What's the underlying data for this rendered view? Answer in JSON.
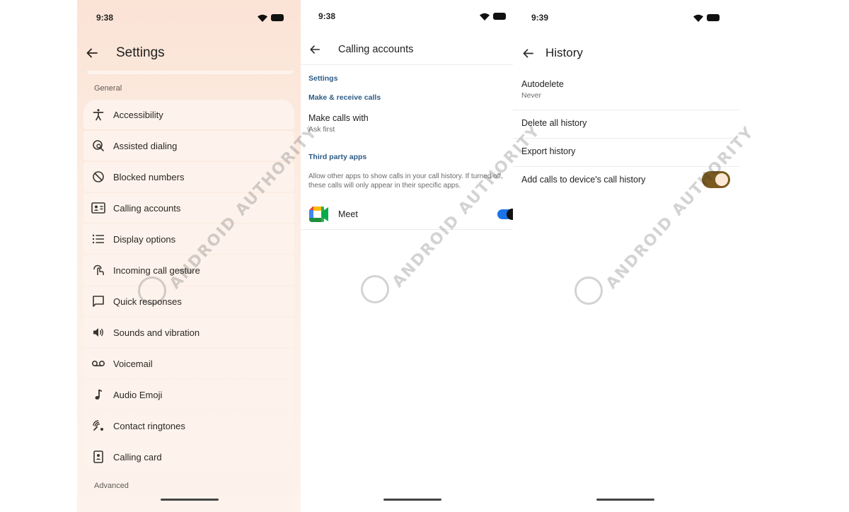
{
  "settings_screen": {
    "time": "9:38",
    "title": "Settings",
    "general_label": "General",
    "advanced_label": "Advanced",
    "items": [
      {
        "label": "Accessibility",
        "icon": "accessibility-icon"
      },
      {
        "label": "Assisted dialing",
        "icon": "assisted-dialing-icon"
      },
      {
        "label": "Blocked numbers",
        "icon": "block-icon"
      },
      {
        "label": "Calling accounts",
        "icon": "contact-card-icon"
      },
      {
        "label": "Display options",
        "icon": "list-icon"
      },
      {
        "label": "Incoming call gesture",
        "icon": "gesture-icon"
      },
      {
        "label": "Quick responses",
        "icon": "chat-bubble-icon"
      },
      {
        "label": "Sounds and vibration",
        "icon": "volume-icon"
      },
      {
        "label": "Voicemail",
        "icon": "voicemail-icon"
      },
      {
        "label": "Audio Emoji",
        "icon": "music-note-icon"
      },
      {
        "label": "Contact ringtones",
        "icon": "ringtone-icon"
      },
      {
        "label": "Calling card",
        "icon": "calling-card-icon"
      }
    ]
  },
  "calling_accounts_screen": {
    "time": "9:38",
    "title": "Calling accounts",
    "settings_header": "Settings",
    "make_receive_header": "Make & receive calls",
    "make_calls_title": "Make calls with",
    "make_calls_value": "Ask first",
    "third_party_header": "Third party apps",
    "third_party_desc": "Allow other apps to show calls in your call history. If turned off, these calls will only appear in their specific apps.",
    "meet_label": "Meet",
    "meet_toggle_on": true
  },
  "history_screen": {
    "time": "9:39",
    "title": "History",
    "autodelete_title": "Autodelete",
    "autodelete_value": "Never",
    "delete_all_label": "Delete all history",
    "export_label": "Export history",
    "add_calls_label": "Add calls to device's call history",
    "add_calls_toggle_on": true
  },
  "watermark": {
    "text": "ANDROID AUTHORITY"
  },
  "colors": {
    "accent_blue": "#2d5c86",
    "toggle_brown": "#7a5a1f",
    "toggle_blue": "#1a73e8"
  }
}
